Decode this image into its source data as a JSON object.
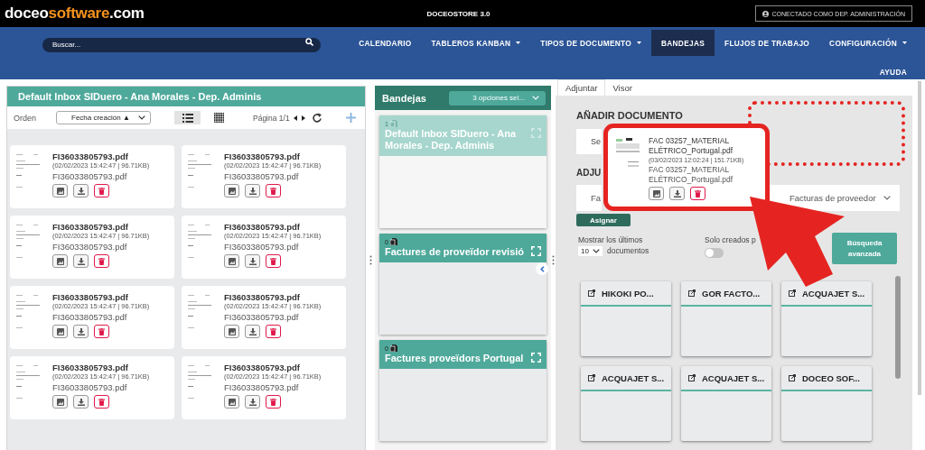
{
  "top_bar": {
    "logo": {
      "prefix": "doceo",
      "highlight": "software",
      "suffix": ".com"
    },
    "title": "DOCEOSTORE 3.0",
    "connection": "CONECTADO COMO DEP. ADMINISTRACIÓN"
  },
  "nav": {
    "search": {
      "placeholder": "Buscar..."
    },
    "items": [
      {
        "label": "CALENDARIO",
        "dropdown": false,
        "selected": false
      },
      {
        "label": "TABLEROS KANBAN",
        "dropdown": true,
        "selected": false
      },
      {
        "label": "TIPOS DE DOCUMENTO",
        "dropdown": true,
        "selected": false
      },
      {
        "label": "BANDEJAS",
        "dropdown": false,
        "selected": true
      },
      {
        "label": "FLUJOS DE TRABAJO",
        "dropdown": false,
        "selected": false
      },
      {
        "label": "CONFIGURACIÓN",
        "dropdown": true,
        "selected": false
      },
      {
        "label": "AYUDA",
        "dropdown": false,
        "selected": false
      }
    ]
  },
  "inbox_panel": {
    "title": "Default Inbox SIDuero - Ana Morales - Dep. Adminis",
    "sort_label": "Orden",
    "sort_value": "Fecha creación ▲",
    "view_modes": [
      {
        "kind": "list",
        "selected": true
      },
      {
        "kind": "grid",
        "selected": false
      }
    ],
    "pagination": "Página 1/1",
    "documents": [
      {
        "name": "FI36033805793.pdf",
        "meta": "(02/02/2023 15:42:47 | 96.71KB)",
        "file": "FI36033805793.pdf"
      },
      {
        "name": "FI36033805793.pdf",
        "meta": "(02/02/2023 15:42:47 | 96.71KB)",
        "file": "FI36033805793.pdf"
      },
      {
        "name": "FI36033805793.pdf",
        "meta": "(02/02/2023 15:42:47 | 96.71KB)",
        "file": "FI36033805793.pdf"
      },
      {
        "name": "FI36033805793.pdf",
        "meta": "(02/02/2023 15:42:47 | 96.71KB)",
        "file": "FI36033805793.pdf"
      },
      {
        "name": "FI36033805793.pdf",
        "meta": "(02/02/2023 15:42:47 | 96.71KB)",
        "file": "FI36033805793.pdf"
      },
      {
        "name": "FI36033805793.pdf",
        "meta": "(02/02/2023 15:42:47 | 96.71KB)",
        "file": "FI36033805793.pdf"
      },
      {
        "name": "FI36033805793.pdf",
        "meta": "(02/02/2023 15:42:47 | 96.71KB)",
        "file": "FI36033805793.pdf"
      },
      {
        "name": "FI36033805793.pdf",
        "meta": "(02/02/2023 15:42:47 | 96.71KB)",
        "file": "FI36033805793.pdf"
      }
    ]
  },
  "trays_panel": {
    "title": "Bandejas",
    "filter": "3 opciones sel...",
    "trays": [
      {
        "count": "1",
        "title": "Default Inbox SIDuero - Ana Morales - Dep. Adminis",
        "selected": true
      },
      {
        "count": "0",
        "title": "Factures de proveïdor revisió",
        "selected": false
      },
      {
        "count": "0",
        "title": "Factures proveïdors Portugal",
        "selected": false
      }
    ]
  },
  "attach_panel": {
    "tabs": [
      {
        "label": "Adjuntar",
        "selected": true
      },
      {
        "label": "Visor",
        "selected": false
      }
    ],
    "add_heading": "AÑADIR DOCUMENTO",
    "select_button": "Se",
    "assign_heading": "ADJU",
    "assign_field": {
      "label": "Fa",
      "value": "Facturas de proveedor"
    },
    "assign_button": "Asignar",
    "show_last": {
      "label": "Mostrar los últimos",
      "value": "10",
      "suffix": "documentos"
    },
    "own_only": {
      "label": "Solo creados p",
      "on": false
    },
    "advanced_search": "Búsqueda avanzada",
    "boards": [
      {
        "title": "HIKOKI PO..."
      },
      {
        "title": "GOR FACTO..."
      },
      {
        "title": "ACQUAJET S..."
      },
      {
        "title": "ACQUAJET S..."
      },
      {
        "title": "ACQUAJET S..."
      },
      {
        "title": "DOCEO SOF..."
      }
    ]
  },
  "dragged_document": {
    "name": "FAC 03257_MATERIAL ELÉTRICO_Portugal.pdf",
    "meta": "(03/02/2023 12:02:24 | 151.71KB)",
    "file": "FAC 03257_MATERIAL ELÉTRICO_Portugal.pdf"
  }
}
